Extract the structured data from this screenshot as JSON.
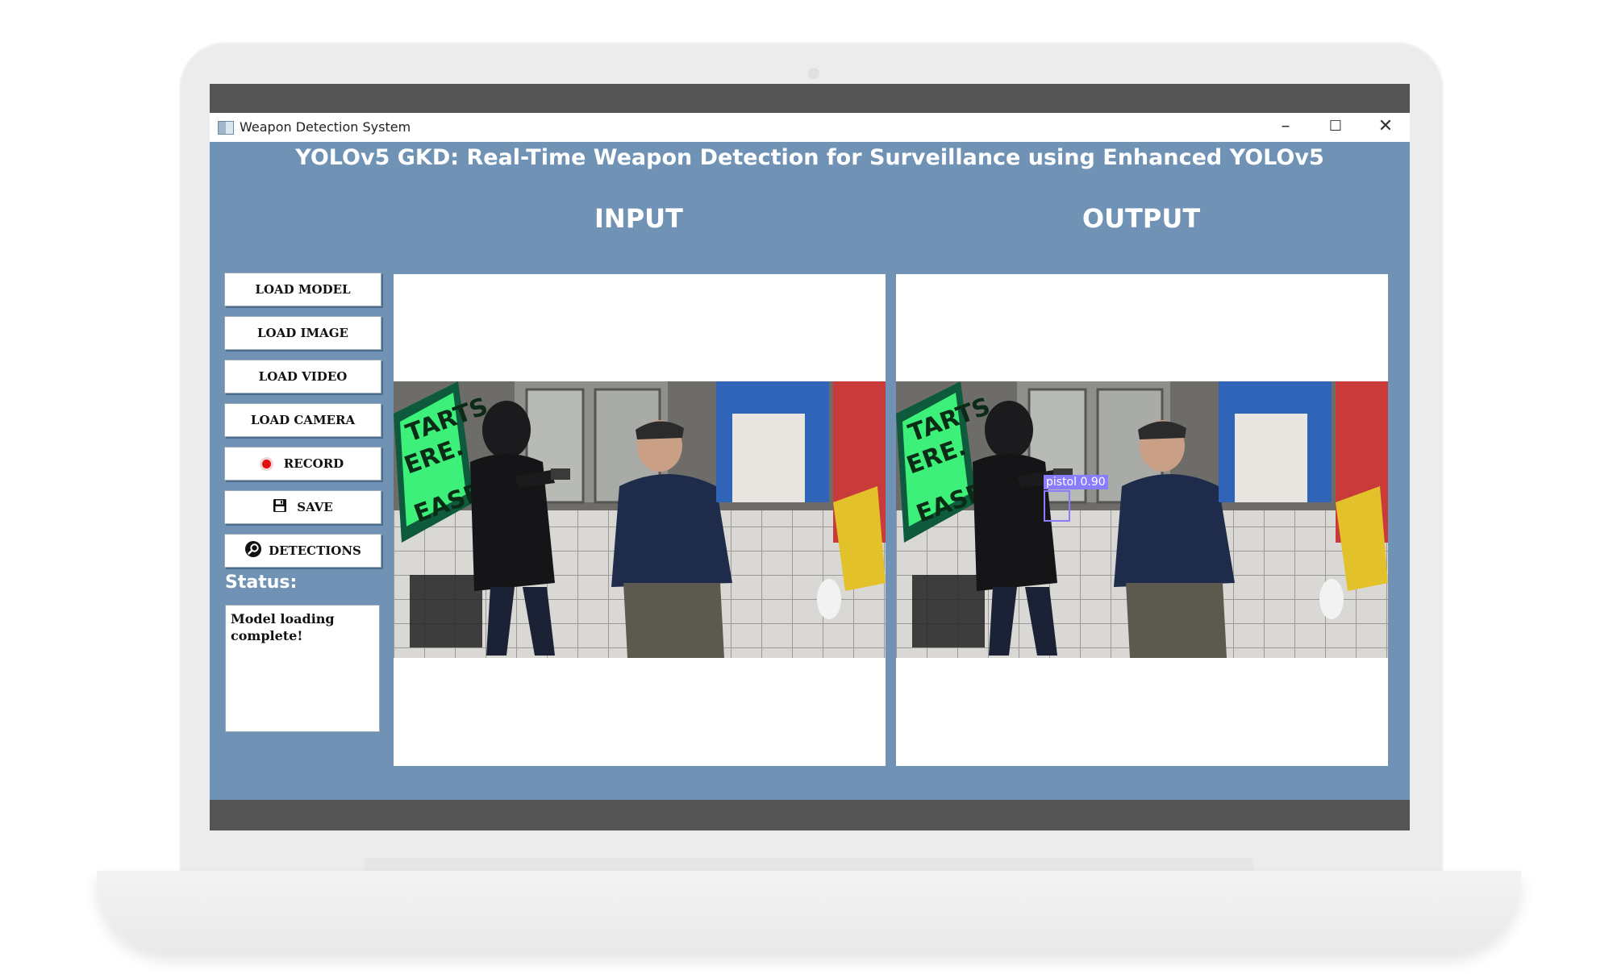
{
  "window": {
    "title": "Weapon Detection System",
    "controls": {
      "minimize": "–",
      "maximize": "☐",
      "close": "✕"
    }
  },
  "app": {
    "header": "YOLOv5 GKD: Real-Time Weapon Detection for Surveillance using Enhanced YOLOv5",
    "input_label": "INPUT",
    "output_label": "OUTPUT"
  },
  "sidebar": {
    "buttons": [
      {
        "label": "LOAD MODEL",
        "icon": ""
      },
      {
        "label": "LOAD IMAGE",
        "icon": ""
      },
      {
        "label": "LOAD VIDEO",
        "icon": ""
      },
      {
        "label": "LOAD CAMERA",
        "icon": ""
      },
      {
        "label": "RECORD",
        "icon": "record-dot-icon"
      },
      {
        "label": "SAVE",
        "icon": "floppy-disk-icon"
      },
      {
        "label": "DETECTIONS",
        "icon": "magnifier-icon"
      }
    ],
    "status_label": "Status:",
    "status_text": "Model loading complete!"
  },
  "detection": {
    "label": "pistol",
    "confidence": "0.90"
  },
  "colors": {
    "window_bg": "#6f92b5",
    "screen_bezel": "#555555",
    "detection_box": "#8a7cff",
    "record_dot": "#e01010"
  }
}
